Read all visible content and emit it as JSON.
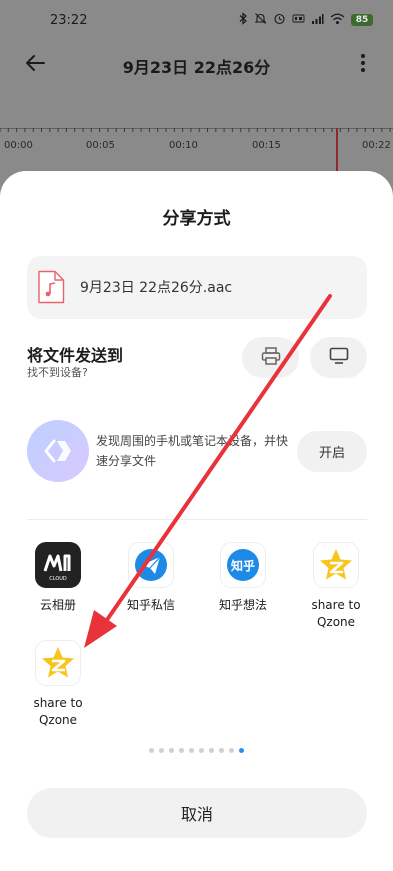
{
  "status_bar": {
    "time": "23:22",
    "battery": "85",
    "icons": [
      "bluetooth-icon",
      "mute-icon",
      "alarm-icon",
      "hd-icon",
      "signal-icon",
      "wifi-icon",
      "battery-icon"
    ]
  },
  "app_bar": {
    "title": "9月23日 22点26分",
    "back_icon": "arrow-left-icon",
    "more_icon": "more-vertical-icon"
  },
  "timeline": {
    "ticks": [
      "00:00",
      "00:05",
      "00:10",
      "00:15",
      "00:22"
    ]
  },
  "share_sheet": {
    "title": "分享方式",
    "file": {
      "name": "9月23日 22点26分.aac",
      "icon": "audio-file-icon",
      "accent": "#e8646c"
    },
    "send_to": {
      "title": "将文件发送到",
      "subtitle": "找不到设备?",
      "print_icon": "printer-icon",
      "screen_icon": "monitor-icon"
    },
    "discover": {
      "text": "发现周围的手机或笔记本设备，并快速分享文件",
      "button": "开启",
      "icon": "nearby-share-icon"
    },
    "apps": [
      {
        "label": "云相册",
        "icon": "cloud-album-icon",
        "bg": "#222222"
      },
      {
        "label": "知乎私信",
        "icon": "paper-plane-icon",
        "bg": "#1e8ae8"
      },
      {
        "label": "知乎想法",
        "icon": "zhihu-icon",
        "bg": "#1e8ae8"
      },
      {
        "label": "share to Qzone",
        "icon": "qzone-star-icon",
        "bg": "#f8c51c"
      },
      {
        "label": "share to Qzone",
        "icon": "qzone-star-icon",
        "bg": "#f8c51c"
      }
    ],
    "page_indicator": {
      "count": 10,
      "active_index": 9,
      "active_color": "#2b8ff0"
    },
    "cancel": "取消"
  },
  "colors": {
    "annotation_arrow": "#e8333a",
    "playhead": "#8f2a2a"
  },
  "logo_text": {
    "cloud_album": "CLOUD",
    "zhihu": "知乎"
  }
}
